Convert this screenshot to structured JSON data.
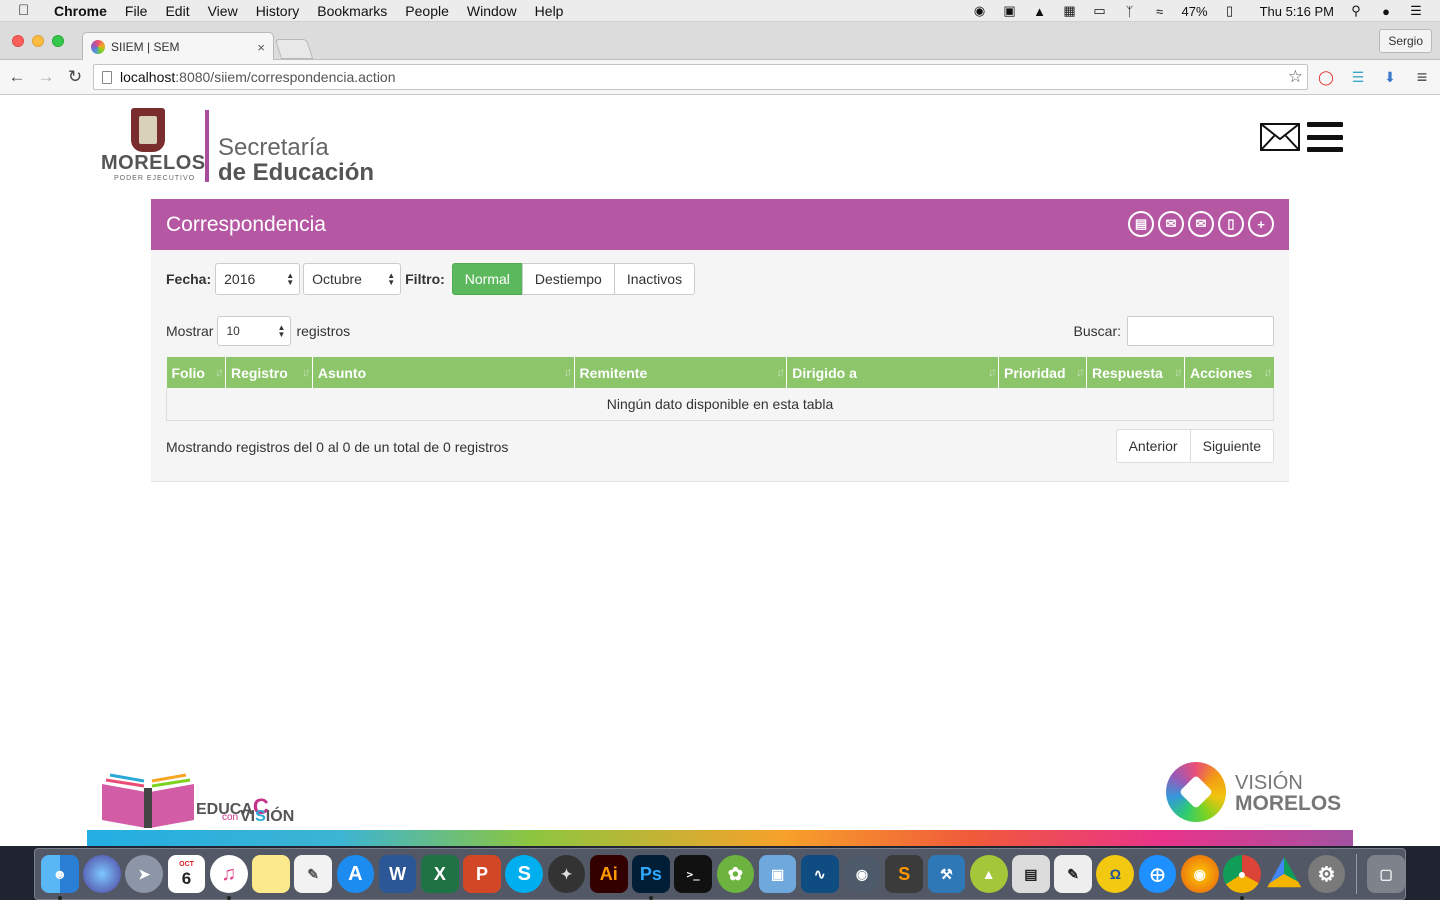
{
  "menubar": {
    "app_name": "Chrome",
    "items": [
      "File",
      "Edit",
      "View",
      "History",
      "Bookmarks",
      "People",
      "Window",
      "Help"
    ],
    "battery": "47%",
    "clock": "Thu 5:16 PM"
  },
  "browser": {
    "tab_title": "SIIEM | SEM",
    "tab_close": "×",
    "profile": "Sergio",
    "url_host": "localhost",
    "url_path": ":8080/siiem/correspondencia.action"
  },
  "header": {
    "logo_morelos": "MORELOS",
    "logo_poder": "PODER EJECUTIVO",
    "logo_sec_line1": "Secretaría",
    "logo_sec_line2": "de Educación"
  },
  "panel": {
    "title": "Correspondencia",
    "fecha_label": "Fecha:",
    "year_value": "2016",
    "month_value": "Octubre",
    "filtro_label": "Filtro:",
    "filters": [
      "Normal",
      "Destiempo",
      "Inactivos"
    ],
    "show_label": "Mostrar",
    "show_value": "10",
    "show_suffix": "registros",
    "search_label": "Buscar:",
    "columns": [
      "Folio",
      "Registro",
      "Asunto",
      "Remitente",
      "Dirigido a",
      "Prioridad",
      "Respuesta",
      "Acciones"
    ],
    "empty_message": "Ningún dato disponible en esta tabla",
    "info": "Mostrando registros del 0 al 0 de un total de 0 registros",
    "prev": "Anterior",
    "next": "Siguiente"
  },
  "footer": {
    "educa": "EDUCA",
    "educa_c": "C",
    "con": "con",
    "vision": "VI",
    "vision_s": "S",
    "vision_end": "IÓN",
    "vm_line1": "VISIÓN",
    "vm_line2": "MORELOS"
  },
  "dock": {
    "calendar_month": "OCT",
    "calendar_day": "6"
  }
}
